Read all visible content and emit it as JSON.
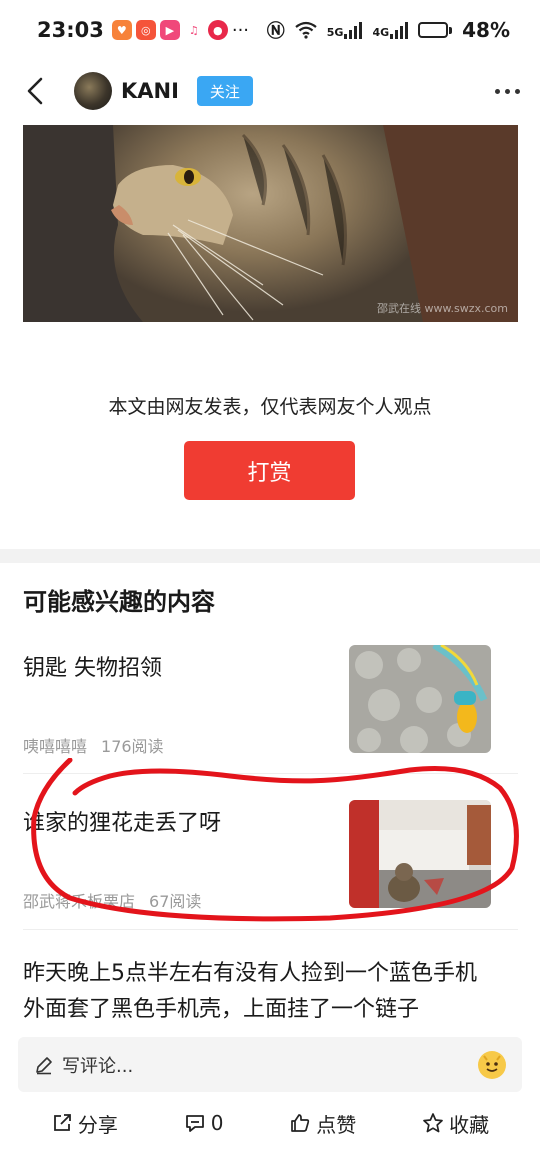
{
  "status_bar": {
    "time": "23:03",
    "network_5g": "5G",
    "network_4g": "4G",
    "battery_percent": "48%",
    "battery_level": 0.48
  },
  "header": {
    "author_name": "KANI",
    "follow_label": "关注"
  },
  "article": {
    "image_watermark": "邵武在线 www.swzx.com",
    "disclaimer": "本文由网友发表，仅代表网友个人观点",
    "reward_label": "打赏"
  },
  "recommendations": {
    "title": "可能感兴趣的内容",
    "items": [
      {
        "title": "钥匙 失物招领",
        "author": "咦嘻嘻嘻",
        "reads": "176阅读"
      },
      {
        "title": "谁家的狸花走丢了呀",
        "author": "邵武蒋禾板栗店",
        "reads": "67阅读"
      }
    ],
    "long_item": {
      "title_line1": "昨天晚上5点半左右有没有人捡到一个蓝色手机",
      "title_line2": "外面套了黑色手机壳，上面挂了一个链子"
    }
  },
  "bottom": {
    "comment_placeholder": "写评论...",
    "share_label": "分享",
    "comment_count": "0",
    "like_label": "点赞",
    "favorite_label": "收藏"
  },
  "colors": {
    "accent_red": "#f03c32",
    "follow_blue": "#3aa7f3",
    "annotation_red": "#e3141b"
  }
}
